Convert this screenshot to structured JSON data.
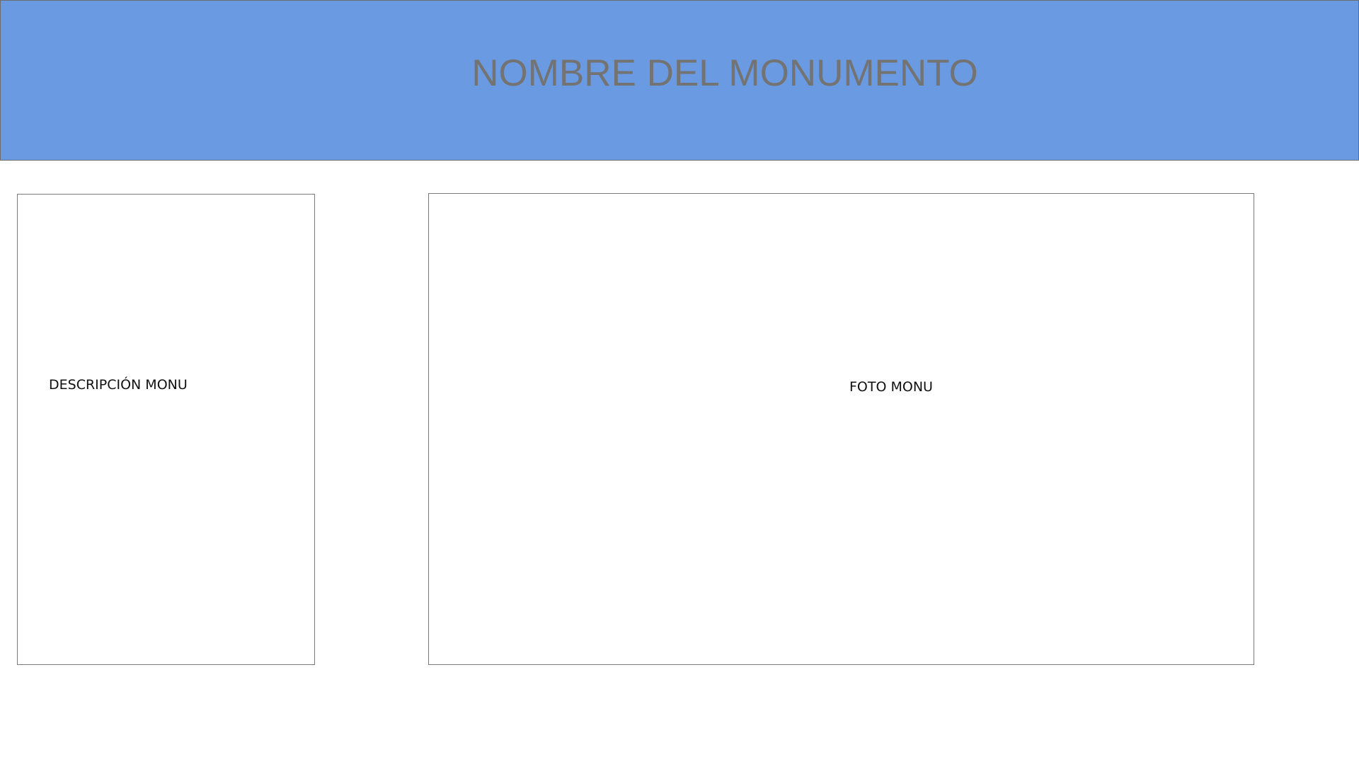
{
  "header": {
    "title": "NOMBRE DEL MONUMENTO",
    "background_color": "#6a9be2",
    "title_color": "#737373"
  },
  "description_panel": {
    "label": "DESCRIPCIÓN MONU"
  },
  "photo_panel": {
    "label": "FOTO MONU"
  }
}
